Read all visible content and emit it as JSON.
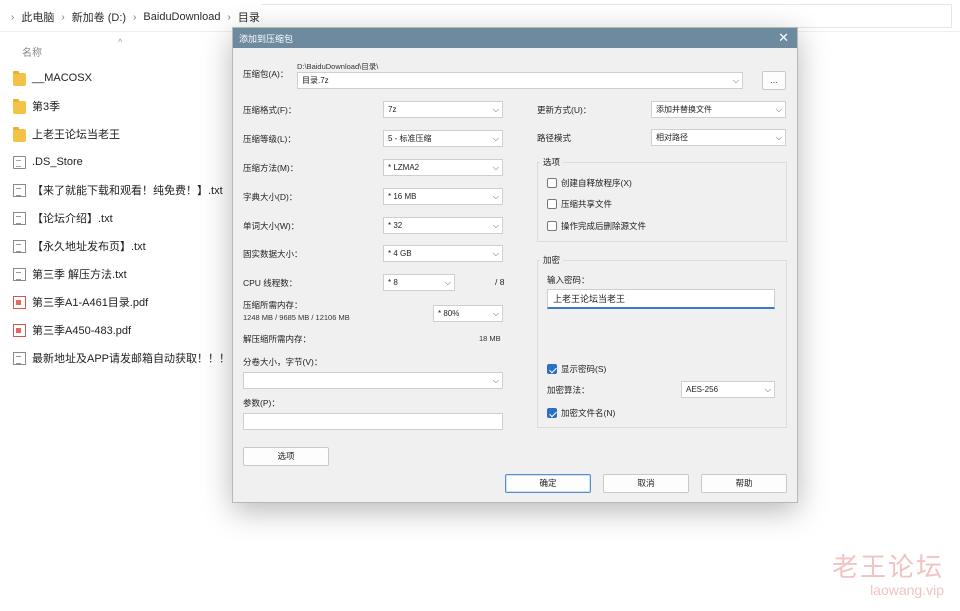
{
  "explorer": {
    "breadcrumb": [
      "此电脑",
      "新加卷 (D:)",
      "BaiduDownload",
      "目录"
    ],
    "column_name": "名称",
    "files": [
      {
        "name": "__MACOSX",
        "type": "folder"
      },
      {
        "name": "第3季",
        "type": "folder"
      },
      {
        "name": "上老王论坛当老王",
        "type": "folder"
      },
      {
        "name": ".DS_Store",
        "type": "file"
      },
      {
        "name": "【来了就能下载和观看！纯免费！】.txt",
        "type": "txt"
      },
      {
        "name": "【论坛介绍】.txt",
        "type": "txt"
      },
      {
        "name": "【永久地址发布页】.txt",
        "type": "txt"
      },
      {
        "name": "第三季 解压方法.txt",
        "type": "txt"
      },
      {
        "name": "第三季A1-A461目录.pdf",
        "type": "pdf"
      },
      {
        "name": "第三季A450-483.pdf",
        "type": "pdf"
      },
      {
        "name": "最新地址及APP请发邮箱自动获取！！！ ...",
        "type": "txt"
      }
    ]
  },
  "dialog": {
    "title": "添加到压缩包",
    "close_icon": "close-icon",
    "archive_label": "压缩包(A)：",
    "archive_path": "D:\\BaiduDownload\\目录\\",
    "archive_name": "目录.7z",
    "browse_label": "...",
    "format_label": "压缩格式(F)：",
    "format_value": "7z",
    "level_label": "压缩等级(L)：",
    "level_value": "5 - 标准压缩",
    "method_label": "压缩方法(M)：",
    "method_value": "* LZMA2",
    "dict_label": "字典大小(D)：",
    "dict_value": "* 16 MB",
    "word_label": "单词大小(W)：",
    "word_value": "* 32",
    "solid_label": "固实数据大小：",
    "solid_value": "* 4 GB",
    "cpu_label": "CPU 线程数：",
    "cpu_value": "* 8",
    "cpu_total": "/ 8",
    "mem_label": "压缩所需内存：",
    "mem_detail": "1248 MB / 9685 MB / 12106 MB",
    "mem_percent": "* 80%",
    "decomp_label": "解压缩所需内存：",
    "decomp_value": "18 MB",
    "split_label": "分卷大小，字节(V)：",
    "split_value": "",
    "params_label": "参数(P)：",
    "params_value": "",
    "options_button": "选项",
    "update_label": "更新方式(U)：",
    "update_value": "添加并替换文件",
    "path_label": "路径模式",
    "path_value": "相对路径",
    "options_group": "选项",
    "opt_sfx": "创建自释放程序(X)",
    "opt_shared": "压缩共享文件",
    "opt_delete": "操作完成后删除源文件",
    "encrypt_group": "加密",
    "password_label": "输入密码：",
    "password_value": "上老王论坛当老王",
    "show_password": "显示密码(S)",
    "enc_method_label": "加密算法：",
    "enc_method_value": "AES-256",
    "encrypt_names": "加密文件名(N)",
    "ok_button": "确定",
    "cancel_button": "取消",
    "help_button": "帮助"
  },
  "watermark": {
    "line1": "老王论坛",
    "line2": "laowang.vip"
  },
  "colors": {
    "titlebar": "#6e8a9e",
    "accent": "#2c6fc4",
    "watermark": "#f1c3c3"
  }
}
